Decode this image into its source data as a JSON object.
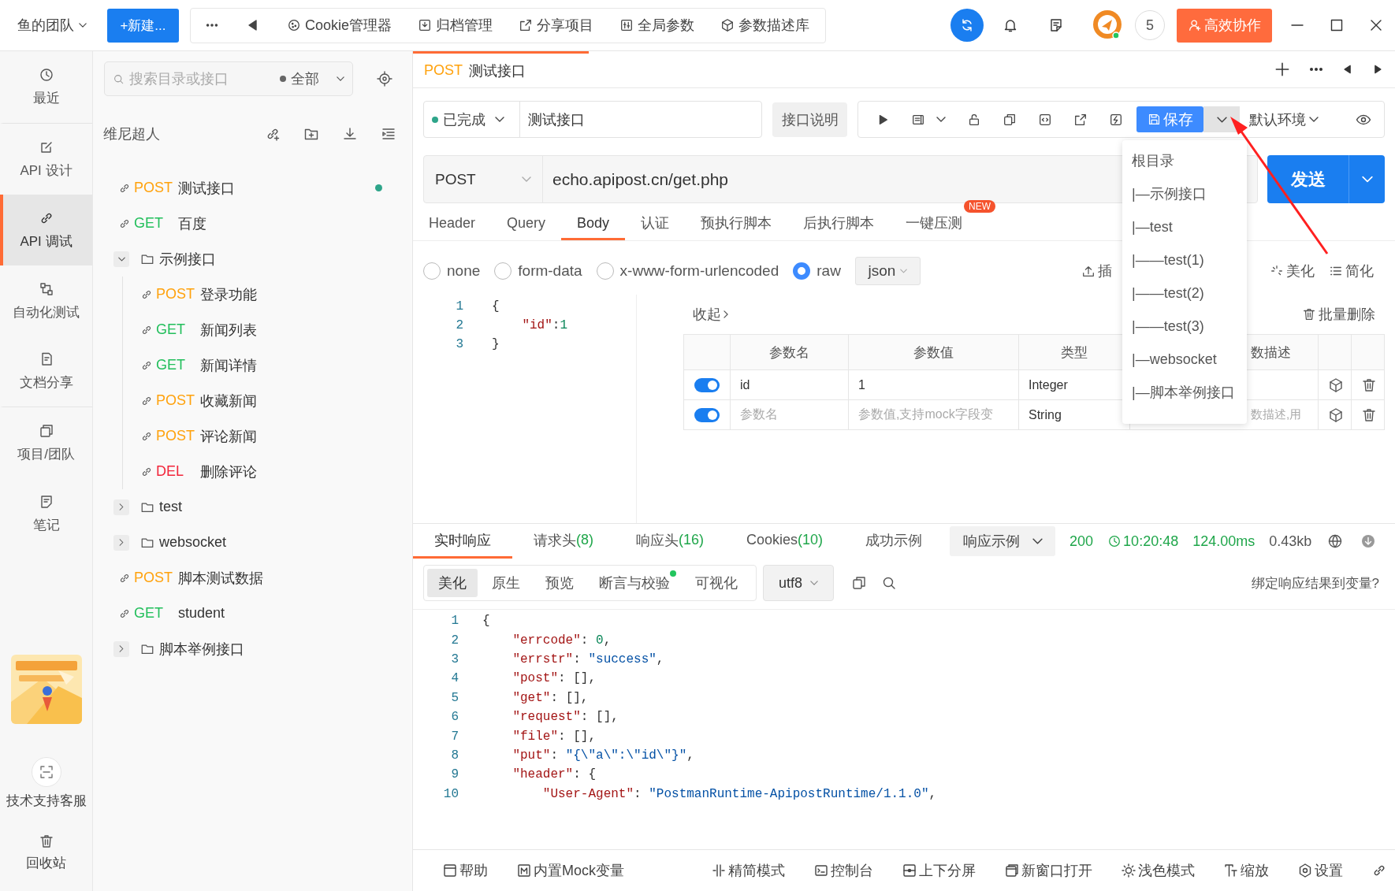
{
  "top_bar": {
    "team": "鱼的团队",
    "new_button": "+新建...",
    "tools": [
      {
        "kind": "cookie",
        "label": "Cookie管理器"
      },
      {
        "kind": "archive",
        "label": "归档管理"
      },
      {
        "kind": "share",
        "label": "分享项目"
      },
      {
        "kind": "params",
        "label": "全局参数"
      },
      {
        "kind": "box",
        "label": "参数描述库"
      }
    ],
    "member_count": "5",
    "collab_button": "高效协作"
  },
  "nav": {
    "items": [
      {
        "kind": "recent",
        "label": "最近",
        "selected": false
      },
      {
        "kind": "design",
        "label": "API 设计",
        "selected": false
      },
      {
        "kind": "debug",
        "label": "API 调试",
        "selected": true
      },
      {
        "kind": "auto",
        "label": "自动化测试",
        "selected": false
      },
      {
        "kind": "share",
        "label": "文档分享",
        "selected": false
      },
      {
        "kind": "project",
        "label": "项目/团队",
        "selected": false
      },
      {
        "kind": "note",
        "label": "笔记",
        "selected": false
      }
    ],
    "support": "技术支持客服",
    "trash": "回收站"
  },
  "tree": {
    "search_placeholder": "搜索目录或接口",
    "filter": "全部",
    "owner": "维尼超人",
    "items": [
      {
        "kind": "api",
        "method": "POST",
        "color": "#ffa20d",
        "name": "测试接口",
        "modified": true
      },
      {
        "kind": "api",
        "method": "GET",
        "color": "#23bf5c",
        "name": "百度",
        "modified": false
      },
      {
        "kind": "folder",
        "name": "示例接口",
        "expanded": true,
        "children": [
          {
            "kind": "api",
            "method": "POST",
            "color": "#ffa20d",
            "name": "登录功能",
            "modified": false
          },
          {
            "kind": "api",
            "method": "GET",
            "color": "#23bf5c",
            "name": "新闻列表",
            "modified": false
          },
          {
            "kind": "api",
            "method": "GET",
            "color": "#23bf5c",
            "name": "新闻详情",
            "modified": false
          },
          {
            "kind": "api",
            "method": "POST",
            "color": "#ffa20d",
            "name": "收藏新闻",
            "modified": false
          },
          {
            "kind": "api",
            "method": "POST",
            "color": "#ffa20d",
            "name": "评论新闻",
            "modified": false
          },
          {
            "kind": "api",
            "method": "DEL",
            "color": "#f2263b",
            "name": "删除评论",
            "modified": false
          }
        ]
      },
      {
        "kind": "folder",
        "name": "test",
        "expanded": false
      },
      {
        "kind": "folder",
        "name": "websocket",
        "expanded": false
      },
      {
        "kind": "api",
        "method": "POST",
        "color": "#ffa20d",
        "name": "脚本测试数据",
        "modified": false
      },
      {
        "kind": "api",
        "method": "GET",
        "color": "#23bf5c",
        "name": "student",
        "modified": false
      },
      {
        "kind": "folder",
        "name": "脚本举例接口",
        "expanded": false
      }
    ]
  },
  "tab": {
    "method": "POST",
    "title": "测试接口"
  },
  "request": {
    "status": "已完成",
    "name": "测试接口",
    "doc_button": "接口说明",
    "save_button": "保存",
    "environment": "默认环境",
    "method": "POST",
    "url": "echo.apipost.cn/get.php",
    "send_button": "发送",
    "tabs": [
      {
        "label": "Header",
        "selected": false
      },
      {
        "label": "Query",
        "selected": false
      },
      {
        "label": "Body",
        "selected": true
      },
      {
        "label": "认证",
        "selected": false
      },
      {
        "label": "预执行脚本",
        "selected": false
      },
      {
        "label": "后执行脚本",
        "selected": false
      },
      {
        "label": "一键压测",
        "selected": false,
        "badge": "NEW"
      }
    ],
    "body_types": [
      {
        "label": "none",
        "selected": false
      },
      {
        "label": "form-data",
        "selected": false
      },
      {
        "label": "x-www-form-urlencoded",
        "selected": false
      },
      {
        "label": "raw",
        "selected": true
      }
    ],
    "format": "json",
    "insert": "插",
    "beautify": "美化",
    "simplify": "简化",
    "code_lines": [
      {
        "number": "1",
        "tokens": [
          {
            "kind": "punct",
            "text": "{"
          }
        ]
      },
      {
        "number": "2",
        "tokens": [
          {
            "kind": "key",
            "text": "    \"id\""
          },
          {
            "kind": "punct",
            "text": ":"
          },
          {
            "kind": "num",
            "text": "1"
          }
        ]
      },
      {
        "number": "3",
        "tokens": [
          {
            "kind": "punct",
            "text": "}"
          }
        ]
      }
    ],
    "collapse": "收起",
    "bulk_delete": "批量删除",
    "param_columns": [
      "参数名",
      "参数值",
      "类型",
      "数描述"
    ],
    "params": [
      {
        "on": true,
        "name": "id",
        "value": "1",
        "type": "Integer"
      },
      {
        "on": true,
        "name_placeholder": "参数名",
        "value_placeholder": "参数值,支持mock字段变",
        "type": "String",
        "description_placeholder": "数描述,用"
      }
    ]
  },
  "save_menu": {
    "items": [
      "根目录",
      "|—示例接口",
      "|—test",
      "|——test(1)",
      "|——test(2)",
      "|——test(3)",
      "|—websocket",
      "|—脚本举例接口"
    ]
  },
  "response": {
    "tabs": [
      {
        "label": "实时响应",
        "selected": true
      },
      {
        "label": "请求头",
        "count": "(8)",
        "selected": false
      },
      {
        "label": "响应头",
        "count": "(16)",
        "selected": false
      },
      {
        "label": "Cookies",
        "count": "(10)",
        "selected": false
      },
      {
        "label": "成功示例",
        "selected": false
      }
    ],
    "example_select": "响应示例",
    "status_code": "200",
    "time": "10:20:48",
    "duration": "124.00ms",
    "size": "0.43kb",
    "views": [
      {
        "label": "美化",
        "selected": true,
        "indicator": false
      },
      {
        "label": "原生",
        "selected": false,
        "indicator": false
      },
      {
        "label": "预览",
        "selected": false,
        "indicator": false
      },
      {
        "label": "断言与校验",
        "selected": false,
        "indicator": true
      },
      {
        "label": "可视化",
        "selected": false,
        "indicator": false
      }
    ],
    "encoding": "utf8",
    "bind_link": "绑定响应结果到变量?",
    "code_lines": [
      {
        "number": "1",
        "tokens": [
          {
            "kind": "punct",
            "text": "{"
          }
        ]
      },
      {
        "number": "2",
        "tokens": [
          {
            "kind": "key",
            "text": "    \"errcode\""
          },
          {
            "kind": "punct",
            "text": ": "
          },
          {
            "kind": "num",
            "text": "0"
          },
          {
            "kind": "punct",
            "text": ","
          }
        ]
      },
      {
        "number": "3",
        "tokens": [
          {
            "kind": "key",
            "text": "    \"errstr\""
          },
          {
            "kind": "punct",
            "text": ": "
          },
          {
            "kind": "str",
            "text": "\"success\""
          },
          {
            "kind": "punct",
            "text": ","
          }
        ]
      },
      {
        "number": "4",
        "tokens": [
          {
            "kind": "key",
            "text": "    \"post\""
          },
          {
            "kind": "punct",
            "text": ": [],"
          }
        ]
      },
      {
        "number": "5",
        "tokens": [
          {
            "kind": "key",
            "text": "    \"get\""
          },
          {
            "kind": "punct",
            "text": ": [],"
          }
        ]
      },
      {
        "number": "6",
        "tokens": [
          {
            "kind": "key",
            "text": "    \"request\""
          },
          {
            "kind": "punct",
            "text": ": [],"
          }
        ]
      },
      {
        "number": "7",
        "tokens": [
          {
            "kind": "key",
            "text": "    \"file\""
          },
          {
            "kind": "punct",
            "text": ": [],"
          }
        ]
      },
      {
        "number": "8",
        "tokens": [
          {
            "kind": "key",
            "text": "    \"put\""
          },
          {
            "kind": "punct",
            "text": ": "
          },
          {
            "kind": "str",
            "text": "\"{\\\"a\\\":\\\"id\\\"}\""
          },
          {
            "kind": "punct",
            "text": ","
          }
        ]
      },
      {
        "number": "9",
        "tokens": [
          {
            "kind": "key",
            "text": "    \"header\""
          },
          {
            "kind": "punct",
            "text": ": {"
          }
        ]
      },
      {
        "number": "10",
        "tokens": [
          {
            "kind": "key",
            "text": "        \"User-Agent\""
          },
          {
            "kind": "punct",
            "text": ": "
          },
          {
            "kind": "str",
            "text": "\"PostmanRuntime-ApipostRuntime/1.1.0\""
          },
          {
            "kind": "punct",
            "text": ","
          }
        ]
      }
    ]
  },
  "status_bar": {
    "items": [
      {
        "kind": "help",
        "label": "帮助"
      },
      {
        "kind": "mock",
        "label": "内置Mock变量"
      },
      {
        "kind": "compact",
        "label": "精简模式"
      },
      {
        "kind": "console",
        "label": "控制台"
      },
      {
        "kind": "split",
        "label": "上下分屏"
      },
      {
        "kind": "newwin",
        "label": "新窗口打开"
      },
      {
        "kind": "theme",
        "label": "浅色模式"
      },
      {
        "kind": "zoom",
        "label": "缩放"
      },
      {
        "kind": "settings",
        "label": "设置"
      }
    ]
  }
}
